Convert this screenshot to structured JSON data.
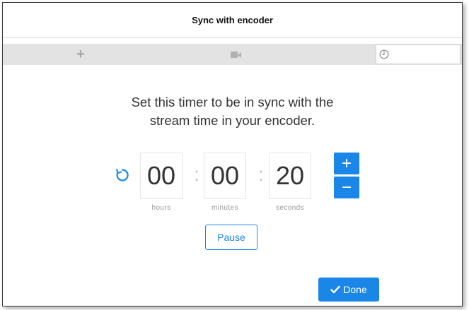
{
  "dialog": {
    "title": "Sync with encoder"
  },
  "tabs": [
    {
      "icon": "plus-icon",
      "label": "+"
    },
    {
      "icon": "video-camera-icon"
    },
    {
      "icon": "clock-icon",
      "active": true
    }
  ],
  "instruction": {
    "line1": "Set this timer to be in sync with the",
    "line2": "stream time in your encoder."
  },
  "timer": {
    "hours": "00",
    "minutes": "00",
    "seconds": "20",
    "separator": ":",
    "hours_label": "hours",
    "minutes_label": "minutes",
    "seconds_label": "seconds",
    "increment_label": "+",
    "decrement_label": "−"
  },
  "buttons": {
    "pause": "Pause",
    "done": "Done"
  },
  "colors": {
    "accent": "#1a87e8",
    "tab_bar": "#e3e3e3",
    "text": "#333333"
  }
}
